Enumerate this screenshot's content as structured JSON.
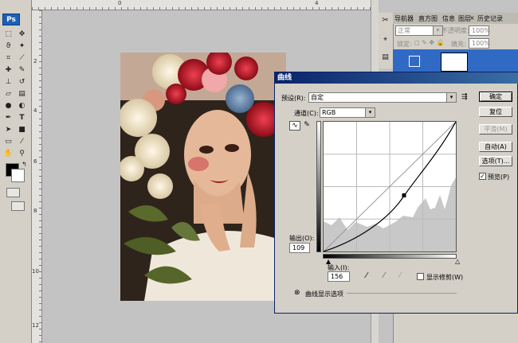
{
  "app": {
    "logo": "Ps"
  },
  "ruler": {
    "top": [
      "0",
      "4"
    ],
    "left": [
      "2",
      "4",
      "6",
      "8",
      "10",
      "12"
    ]
  },
  "panels": {
    "tabs": [
      "导航器",
      "直方图",
      "信息",
      "图层",
      "历史记录"
    ],
    "blend_mode": "正常",
    "opacity_label": "不透明度:",
    "opacity_value": "100%",
    "lock_label": "锁定:",
    "fill_label": "填充:",
    "fill_value": "100%"
  },
  "dialog": {
    "title": "曲线",
    "preset_label": "预设(R):",
    "preset_value": "自定",
    "channel_label": "通道(C):",
    "channel_value": "RGB",
    "output_label": "输出(O):",
    "output_value": "109",
    "input_label": "输入(I):",
    "input_value": "156",
    "show_clipping_label": "显示修剪(W)",
    "show_curve_options": "曲线显示选项",
    "buttons": {
      "ok": "确定",
      "reset": "复位",
      "smooth": "平滑(M)",
      "auto": "自动(A)",
      "options": "选项(T)...",
      "preview": "预览(P)"
    }
  }
}
